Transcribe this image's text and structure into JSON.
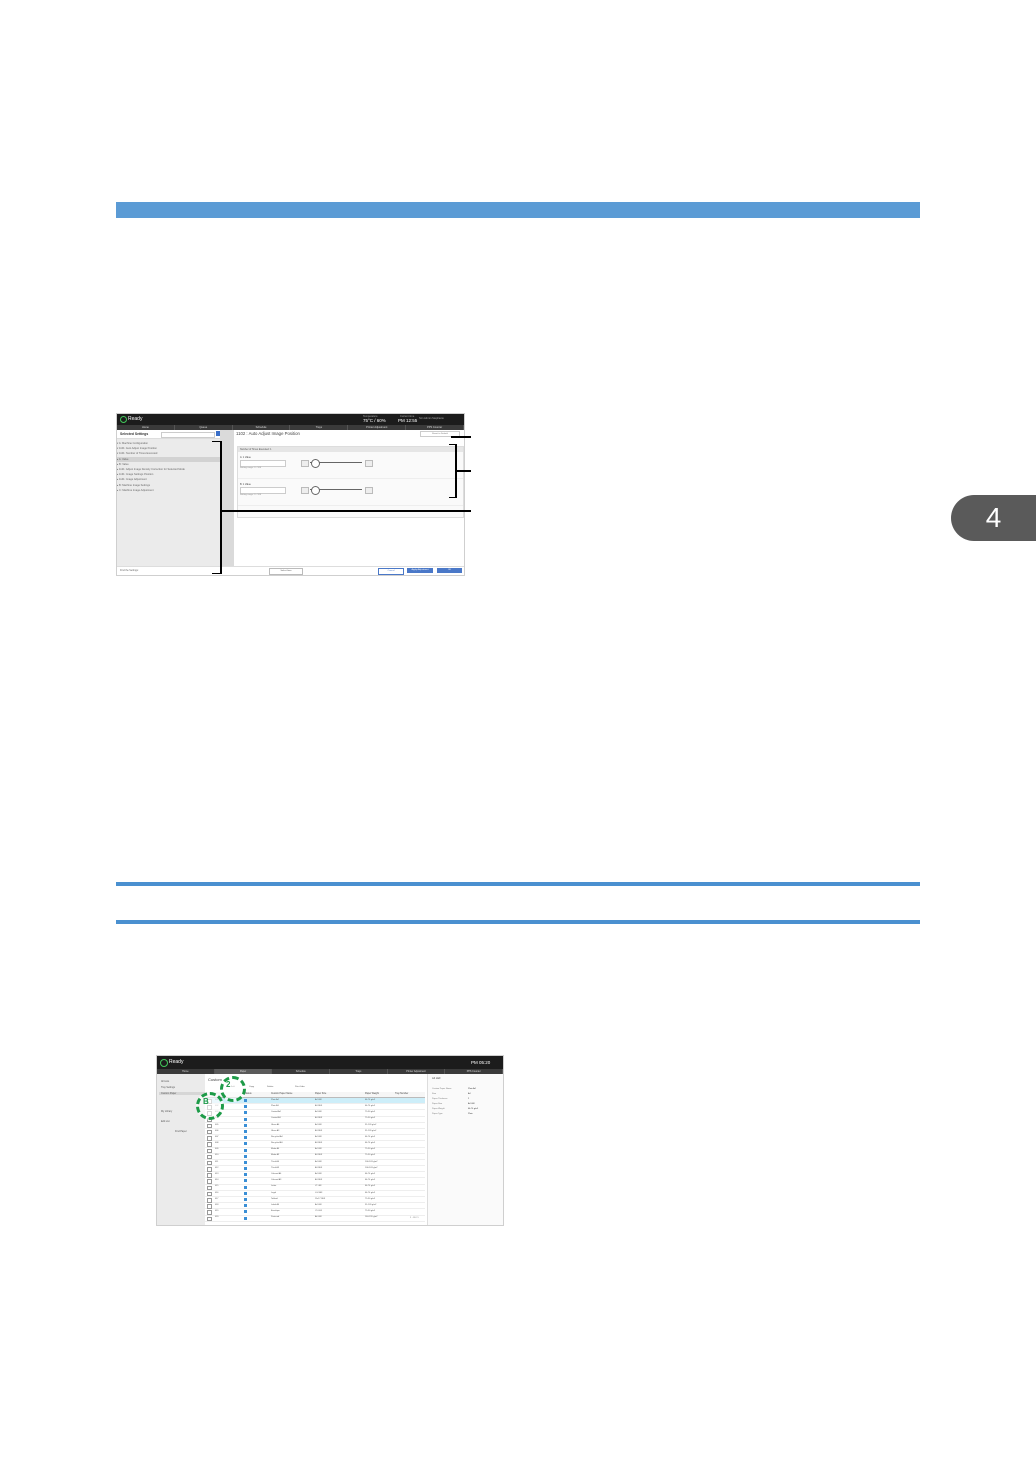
{
  "chapter": {
    "number": "4"
  },
  "screenshot1": {
    "status": "Ready",
    "temp_label": "Temperature",
    "temp_value": "75°C / 60%",
    "time_label": "Current time",
    "time_value": "PM 12:55",
    "user": "Sim Admin   Stephanie",
    "nav_tabs": [
      "Home",
      "Queue",
      "Schedule",
      "Trays",
      "Printer Adjustment",
      "PPS Counter"
    ],
    "left_title": "Selected Settings",
    "tree": [
      "▾ A: Machine Configuration",
      "  ▾ 1101: Auto Adjust Image Position",
      "    ▾ 1101: Number of Times Executed",
      "      ▸ A: Value",
      "      ▸ B: Value",
      "  ▸ 1121: Adjust Image Density Correction for Selected Mode",
      "  ▸ 1131: Image Settings Position",
      "  ▸ 1141: Image Adjustment",
      "▸ B: Machine Image Settings",
      "▸ C: Machine Image Adjustment"
    ],
    "page_title": "1102 : Auto Adjust Image Position",
    "default_btn": "Reset to Default",
    "panel_header": "Number of Times Executed: 1",
    "field1_label": "A: 1 Value",
    "field1_hint": "Setting range: 0 - 100",
    "field2_label": "B: 1 Value",
    "field2_hint": "Setting range: 0 - 100",
    "footer_text": "Find the Settings:",
    "footer_buttons": [
      "Select Item",
      "Cancel",
      "Apply Adjustment",
      "OK"
    ]
  },
  "screenshot2": {
    "status": "Ready",
    "time_value": "PM 05:20",
    "nav_tabs": [
      "Home",
      "Paper",
      "Schedule",
      "Trays",
      "Printer Adjustment",
      "PPS Counter"
    ],
    "left_items": [
      "All Lists",
      "Tray Settings",
      "Custom Paper",
      "My Library",
      "Edit List",
      "Find Paper"
    ],
    "title": "Custom",
    "toolbar": [
      "Add",
      "Copy",
      "Delete",
      "Print Jobs"
    ],
    "columns": [
      "Status",
      "Custom Paper Name",
      "Paper Size",
      "Paper Weight",
      "Tray Number"
    ],
    "rows": [
      [
        "001",
        "Plain A4",
        "A4 LEF",
        "64-74 g/m²"
      ],
      [
        "002",
        "Plain A3",
        "A3 SEF",
        "64-74 g/m²"
      ],
      [
        "003",
        "Coated A4",
        "A4 LEF",
        "75-90 g/m²"
      ],
      [
        "004",
        "Coated A3",
        "A3 SEF",
        "75-90 g/m²"
      ],
      [
        "005",
        "Gloss A4",
        "A4 LEF",
        "91-105 g/m²"
      ],
      [
        "006",
        "Gloss A3",
        "A3 SEF",
        "91-105 g/m²"
      ],
      [
        "007",
        "Recycled A4",
        "A4 LEF",
        "64-74 g/m²"
      ],
      [
        "008",
        "Recycled A3",
        "A3 SEF",
        "64-74 g/m²"
      ],
      [
        "009",
        "Matte A4",
        "A4 LEF",
        "75-90 g/m²"
      ],
      [
        "010",
        "Matte A3",
        "A3 SEF",
        "75-90 g/m²"
      ],
      [
        "011",
        "Thick A4",
        "A4 LEF",
        "106-163 g/m²"
      ],
      [
        "012",
        "Thick A3",
        "A3 SEF",
        "106-163 g/m²"
      ],
      [
        "013",
        "Colored A4",
        "A4 LEF",
        "64-74 g/m²"
      ],
      [
        "014",
        "Colored A3",
        "A3 SEF",
        "64-74 g/m²"
      ],
      [
        "015",
        "Letter",
        "LT LEF",
        "64-74 g/m²"
      ],
      [
        "016",
        "Legal",
        "LG SEF",
        "64-74 g/m²"
      ],
      [
        "017",
        "Tabloid",
        "11x17 SEF",
        "75-90 g/m²"
      ],
      [
        "018",
        "Label A4",
        "A4 LEF",
        "91-105 g/m²"
      ],
      [
        "019",
        "Envelope",
        "C5 LEF",
        "75-90 g/m²"
      ],
      [
        "020",
        "Postcard",
        "A6 LEF",
        "164-220 g/m²"
      ]
    ],
    "pager": "1 - 20 / 1",
    "right_title": "A4 LEF",
    "props": [
      [
        "Custom Paper Name",
        "Plain A4"
      ],
      [
        "Size",
        "A4"
      ],
      [
        "Paper Thickness",
        "2"
      ],
      [
        "Paper Size",
        "A4 LEF"
      ],
      [
        "Paper Weight",
        "64-74 g/m²"
      ],
      [
        "Paper Type",
        "Plain"
      ]
    ],
    "callout_b": "B",
    "callout_2": "2"
  }
}
